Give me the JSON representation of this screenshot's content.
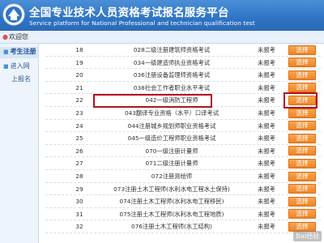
{
  "header": {
    "title_cn": "全国专业技术人员资格考试报名服务平台",
    "title_en": "Service platform for National Professional and technician qualification test"
  },
  "welcome": {
    "text": "欢迎您"
  },
  "sidebar": {
    "items": [
      {
        "label": "考生注册"
      },
      {
        "label": "进入网"
      },
      {
        "label": "上报名"
      }
    ]
  },
  "table": {
    "select_label": "选择",
    "rows": [
      {
        "num": "18",
        "name": "028二级注册建筑师资格考试",
        "status": "未报考"
      },
      {
        "num": "19",
        "name": "034一级建造师执业资格考试",
        "status": "未报考"
      },
      {
        "num": "20",
        "name": "036注册设备监理师资格考试",
        "status": "未报考"
      },
      {
        "num": "21",
        "name": "038社会工作者职业水平考试",
        "status": "未报考"
      },
      {
        "num": "22",
        "name": "042一级消防工程师",
        "status": "未报考"
      },
      {
        "num": "23",
        "name": "043翻译专业资格（水平）口译考试",
        "status": "未报考"
      },
      {
        "num": "24",
        "name": "044注册城乡规划师职业资格考试",
        "status": "未报考"
      },
      {
        "num": "25",
        "name": "045一级造价工程师职业资格考试",
        "status": "未报考"
      },
      {
        "num": "26",
        "name": "070一级注册计量师",
        "status": "未报考"
      },
      {
        "num": "27",
        "name": "071二级注册计量师",
        "status": "未报考"
      },
      {
        "num": "28",
        "name": "072注册测绘师",
        "status": "未报考"
      },
      {
        "num": "29",
        "name": "073注册土木工程师(水利水电工程水土保持)",
        "status": "未报考"
      },
      {
        "num": "30",
        "name": "074注册土木工程师(水利水电工程移民)",
        "status": "未报考"
      },
      {
        "num": "31",
        "name": "075注册土木工程师(水利水电工程地质)",
        "status": "未报考"
      },
      {
        "num": "32",
        "name": "076注册土木工程师(水工结构)",
        "status": "未报考"
      }
    ]
  },
  "colors": {
    "header_bg": "#2f74c4",
    "select_button": "#ef8424",
    "highlight_border": "#b3141b"
  },
  "watermark": "Bai经验"
}
